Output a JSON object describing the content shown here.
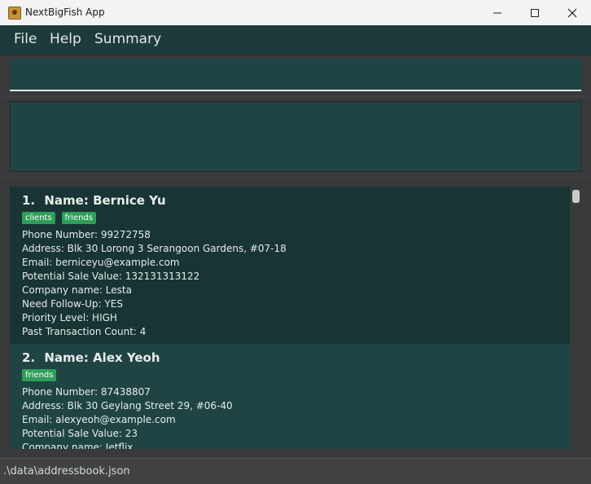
{
  "window": {
    "title": "NextBigFish App",
    "minimize_glyph": "—",
    "maximize_glyph": "☐",
    "close_glyph": "✕"
  },
  "menu": {
    "file": "File",
    "help": "Help",
    "summary": "Summary"
  },
  "command_box": {
    "value": ""
  },
  "result_display": {
    "text": ""
  },
  "persons": [
    {
      "index": "1.",
      "name": "Name: Bernice Yu",
      "tags": [
        "clients",
        "friends"
      ],
      "phone": "Phone Number: 99272758",
      "address": "Address: Blk 30 Lorong 3 Serangoon Gardens, #07-18",
      "email": "Email: berniceyu@example.com",
      "sale_value": "Potential Sale Value: 132131313122",
      "company": "Company name: Lesta",
      "follow_up": "Need Follow-Up: YES",
      "priority": "Priority Level: HIGH",
      "transactions": "Past Transaction Count: 4"
    },
    {
      "index": "2.",
      "name": "Name: Alex Yeoh",
      "tags": [
        "friends"
      ],
      "phone": "Phone Number: 87438807",
      "address": "Address: Blk 30 Geylang Street 29, #06-40",
      "email": "Email: alexyeoh@example.com",
      "sale_value": "Potential Sale Value: 23",
      "company": "Company name: Jetflix"
    }
  ],
  "status_bar": {
    "path": ".\\data\\addressbook.json"
  },
  "colors": {
    "menu_bg": "#1d3b3a",
    "card_dark": "#183434",
    "card_light": "#1f4443",
    "tag_green": "#2f9e5a"
  }
}
